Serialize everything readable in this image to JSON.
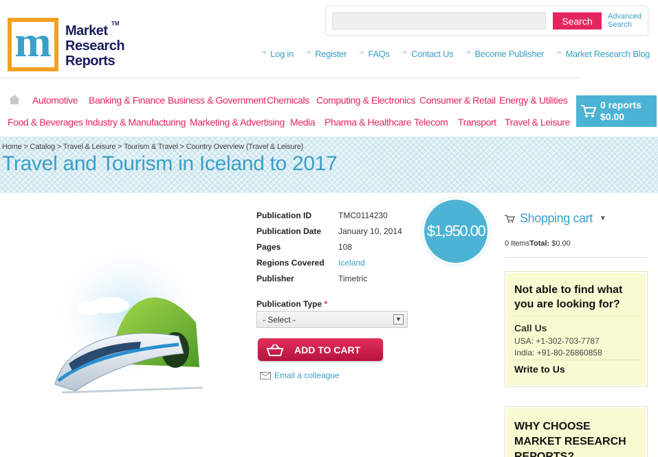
{
  "header": {
    "logo_letter": "m",
    "logo_lines": [
      "Market",
      "Research",
      "Reports"
    ],
    "logo_tm": "TM",
    "search": {
      "placeholder": "",
      "button": "Search",
      "advanced_line1": "Advanced",
      "advanced_line2": "Search"
    },
    "top_links": [
      "Log in",
      "Register",
      "FAQs",
      "Contact Us",
      "Become Publisher",
      "Market Research Blog"
    ]
  },
  "categories": {
    "row1": [
      "Automotive",
      "Banking & Finance",
      "Business & Government",
      "Chemicals",
      "Computing & Electronics",
      "Consumer & Retail",
      "Energy & Utilities"
    ],
    "row2": [
      "Food & Beverages",
      "Industry & Manufacturing",
      "Marketing & Advertising",
      "Media",
      "Pharma & Healthcare",
      "Telecom",
      "Transport",
      "Travel & Leisure"
    ]
  },
  "cart": {
    "reports": "0 reports",
    "total": "$0.00"
  },
  "breadcrumb": [
    "Home",
    "Catalog",
    "Travel & Leisure",
    "Tourism & Travel",
    "Country Overview (Travel & Leisure)"
  ],
  "breadcrumb_sep": " > ",
  "title": "Travel and Tourism in Iceland to 2017",
  "details": [
    {
      "label": "Publication ID",
      "value": "TMC0114230"
    },
    {
      "label": "Publication Date",
      "value": "January 10, 2014"
    },
    {
      "label": "Pages",
      "value": "108"
    },
    {
      "label": "Regions Covered",
      "value": "Iceland"
    },
    {
      "label": "Publisher",
      "value": "Timetric"
    }
  ],
  "price": "$1,950.00",
  "purchase": {
    "type_label": "Publication Type",
    "required_mark": "*",
    "select_value": "- Select -",
    "add_to_cart": "ADD TO CART",
    "email": "Email a colleague"
  },
  "sidebar": {
    "cart_title": "Shopping cart",
    "items_label": "0 Items",
    "total_label": "Total:",
    "total_value": "$0.00",
    "help_title": "Not able to find what you are looking for?",
    "call_us": "Call Us",
    "usa": "USA: +1-302-703-7787",
    "india": "India: +91-80-26860858",
    "write_to_us": "Write to Us",
    "why_title": "WHY CHOOSE MARKET RESEARCH REPORTS?"
  },
  "colors": {
    "accent_blue": "#3aa0c8",
    "accent_pink": "#e1265b",
    "cart_blue": "#4db3d4",
    "help_bg": "#fafad2"
  }
}
